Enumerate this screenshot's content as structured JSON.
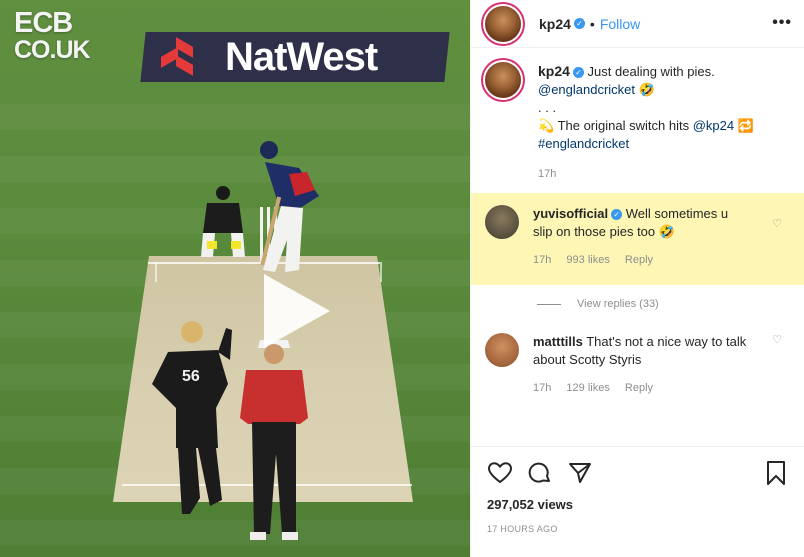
{
  "video": {
    "ecb_line1": "ECB",
    "ecb_line2": "CO.UK",
    "sponsor": "NatWest",
    "bowler_number": "56"
  },
  "post": {
    "username": "kp24",
    "follow_label": "Follow",
    "more_label": "•••",
    "caption_user": "kp24",
    "caption_line1": "Just dealing with pies.",
    "caption_mention": "@englandcricket",
    "caption_emoji": "🤣",
    "caption_dots": ". . .",
    "caption_line2_prefix": "💫",
    "caption_line2": " The original switch hits ",
    "caption_mention2": "@kp24",
    "caption_emoji2": "🔁",
    "caption_hashtag": "#englandcricket",
    "caption_time": "17h"
  },
  "comments": [
    {
      "username": "yuvisofficial",
      "text": " Well sometimes u slip on those pies too",
      "emoji": "🤣",
      "time": "17h",
      "likes": "993 likes",
      "reply": "Reply",
      "view_replies": "View replies (33)"
    },
    {
      "username": "matttills",
      "text": " That's not a nice way to talk about Scotty Styris",
      "time": "17h",
      "likes": "129 likes",
      "reply": "Reply"
    }
  ],
  "footer": {
    "views": "297,052 views",
    "posted": "17 HOURS AGO"
  },
  "colors": {
    "accent": "#3897f0",
    "highlight": "#fdf6b5",
    "pitch": "#d8cfb0"
  }
}
